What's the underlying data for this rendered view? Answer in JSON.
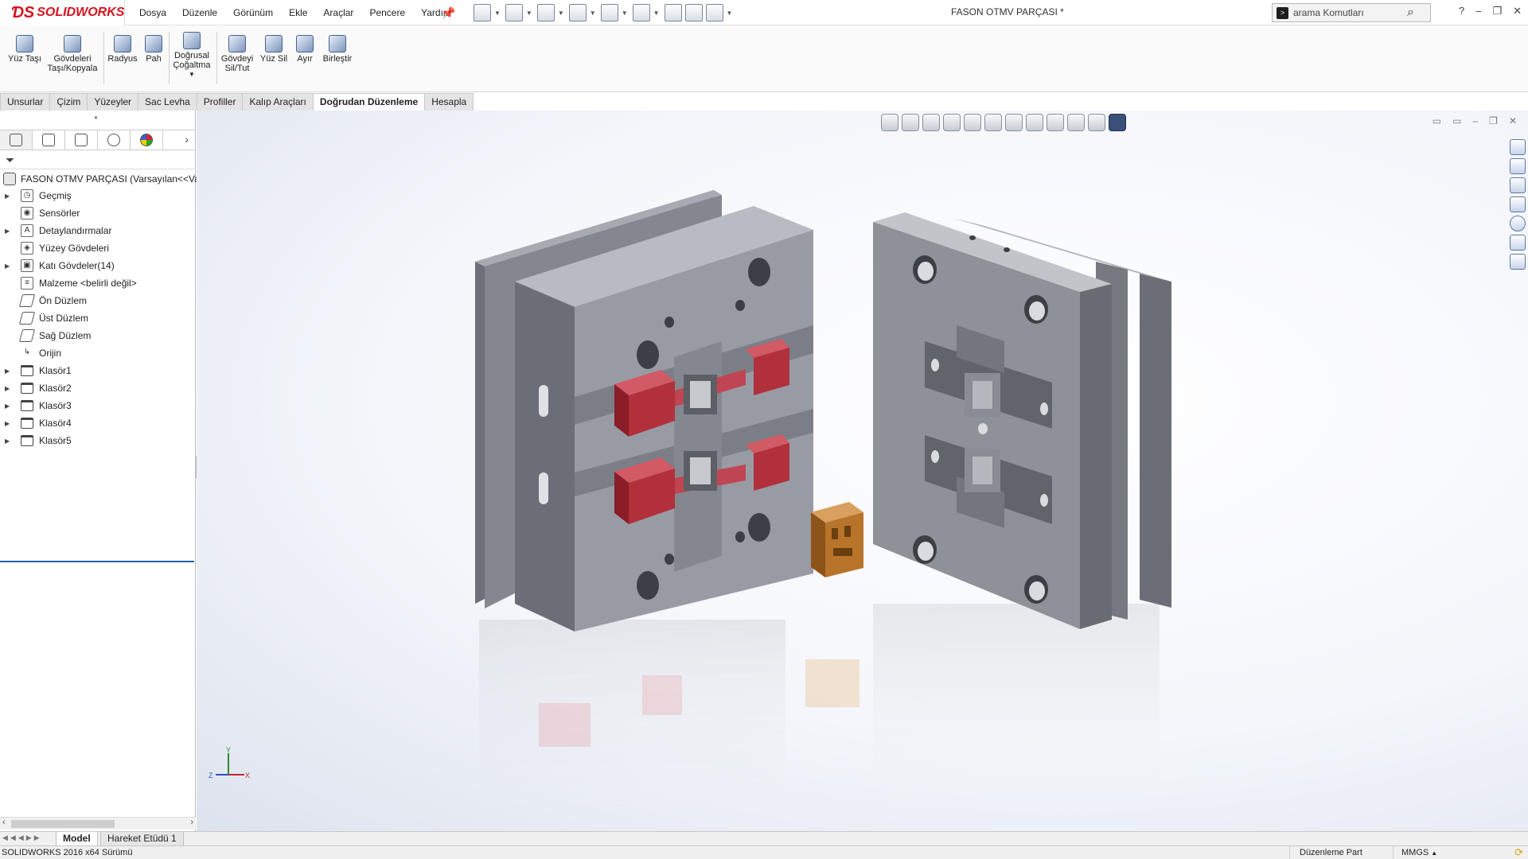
{
  "app": {
    "logo_text": "SOLIDWORKS",
    "document_title": "FASON OTMV PARÇASI *"
  },
  "menu": [
    "Dosya",
    "Düzenle",
    "Görünüm",
    "Ekle",
    "Araçlar",
    "Pencere",
    "Yardım"
  ],
  "search": {
    "placeholder": "arama Komutları"
  },
  "toolbar": {
    "yuz_tasi": "Yüz Taşı",
    "govdeleri_tasi_1": "Gövdeleri",
    "govdeleri_tasi_2": "Taşı/Kopyala",
    "radyus": "Radyus",
    "pah": "Pah",
    "dogrusal_1": "Doğrusal",
    "dogrusal_2": "Çoğaltma",
    "govdeyi_sil_1": "Gövdeyi",
    "govdeyi_sil_2": "Sil/Tut",
    "yuz_sil": "Yüz Sil",
    "ayir": "Ayır",
    "birlestir": "Birleştir"
  },
  "tabs": [
    "Unsurlar",
    "Çizim",
    "Yüzeyler",
    "Sac Levha",
    "Profiller",
    "Kalıp Araçları",
    "Doğrudan Düzenleme",
    "Hesapla"
  ],
  "active_tab": "Doğrudan Düzenleme",
  "tree": {
    "root": "FASON OTMV PARÇASI  (Varsayılan<<Va",
    "items": [
      {
        "label": "Geçmiş",
        "expandable": true,
        "icon": "history-icon"
      },
      {
        "label": "Sensörler",
        "expandable": false,
        "icon": "sensor-icon"
      },
      {
        "label": "Detaylandırmalar",
        "expandable": true,
        "icon": "annotation-icon"
      },
      {
        "label": "Yüzey Gövdeleri",
        "expandable": false,
        "icon": "surface-bodies-icon"
      },
      {
        "label": "Katı Gövdeler(14)",
        "expandable": true,
        "icon": "solid-bodies-icon"
      },
      {
        "label": "Malzeme <belirli değil>",
        "expandable": false,
        "icon": "material-icon"
      },
      {
        "label": "Ön Düzlem",
        "expandable": false,
        "icon": "plane-icon"
      },
      {
        "label": "Üst Düzlem",
        "expandable": false,
        "icon": "plane-icon"
      },
      {
        "label": "Sağ Düzlem",
        "expandable": false,
        "icon": "plane-icon"
      },
      {
        "label": "Orijin",
        "expandable": false,
        "icon": "origin-icon"
      },
      {
        "label": "Klasör1",
        "expandable": true,
        "icon": "folder-icon"
      },
      {
        "label": "Klasör2",
        "expandable": true,
        "icon": "folder-icon"
      },
      {
        "label": "Klasör3",
        "expandable": true,
        "icon": "folder-icon"
      },
      {
        "label": "Klasör4",
        "expandable": true,
        "icon": "folder-icon"
      },
      {
        "label": "Klasör5",
        "expandable": true,
        "icon": "folder-icon"
      }
    ]
  },
  "triad": {
    "x": "X",
    "y": "Y",
    "z": "Z"
  },
  "bottom_tabs": [
    "Model",
    "Hareket Etüdü 1"
  ],
  "status": {
    "version": "SOLIDWORKS 2016 x64 Sürümü",
    "mode": "Düzenleme Part",
    "units": "MMGS"
  },
  "colors": {
    "brand": "#d6121e",
    "plate": "#8e9099",
    "insert_red": "#b1303c",
    "part_orange": "#b8742b",
    "tree_accent": "#1f5fb8"
  }
}
